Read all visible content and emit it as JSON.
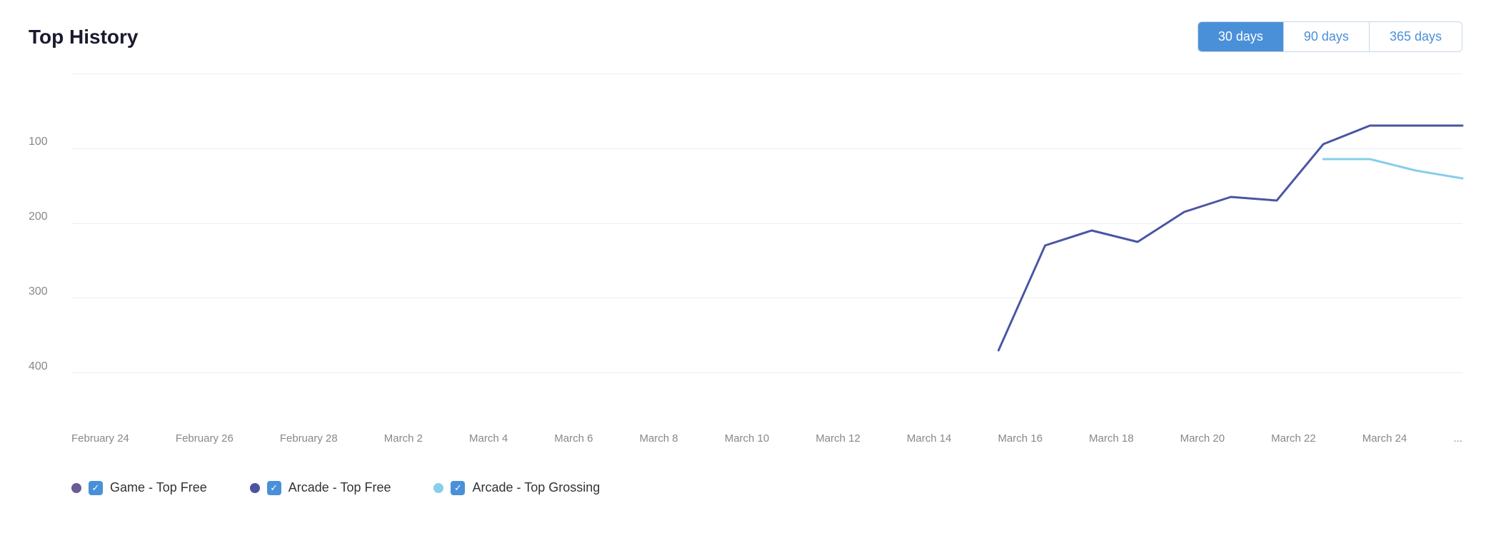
{
  "header": {
    "title": "Top History"
  },
  "timeFilters": {
    "buttons": [
      {
        "label": "30 days",
        "active": true
      },
      {
        "label": "90 days",
        "active": false
      },
      {
        "label": "365 days",
        "active": false
      }
    ]
  },
  "chart": {
    "yAxis": {
      "labels": [
        "",
        "100",
        "200",
        "300",
        "400"
      ]
    },
    "xAxis": {
      "labels": [
        "February 24",
        "February 26",
        "February 28",
        "March 2",
        "March 4",
        "March 6",
        "March 8",
        "March 10",
        "March 12",
        "March 14",
        "March 16",
        "March 18",
        "March 20",
        "March 22",
        "March 24",
        "..."
      ]
    }
  },
  "legend": {
    "items": [
      {
        "label": "Game - Top Free",
        "color": "#6b5b95",
        "checkColor": "#4a90d9"
      },
      {
        "label": "Arcade - Top Free",
        "color": "#4a55a2",
        "checkColor": "#4a90d9"
      },
      {
        "label": "Arcade - Top Grossing",
        "color": "#87ceeb",
        "checkColor": "#4a90d9"
      }
    ]
  },
  "colors": {
    "arcadeTopFree": "#4a55a2",
    "arcadeTopGrossing": "#87ceeb",
    "gameTopFree": "#6b5b95",
    "gridLine": "#e8eef4",
    "activeBtn": "#4a90d9"
  }
}
